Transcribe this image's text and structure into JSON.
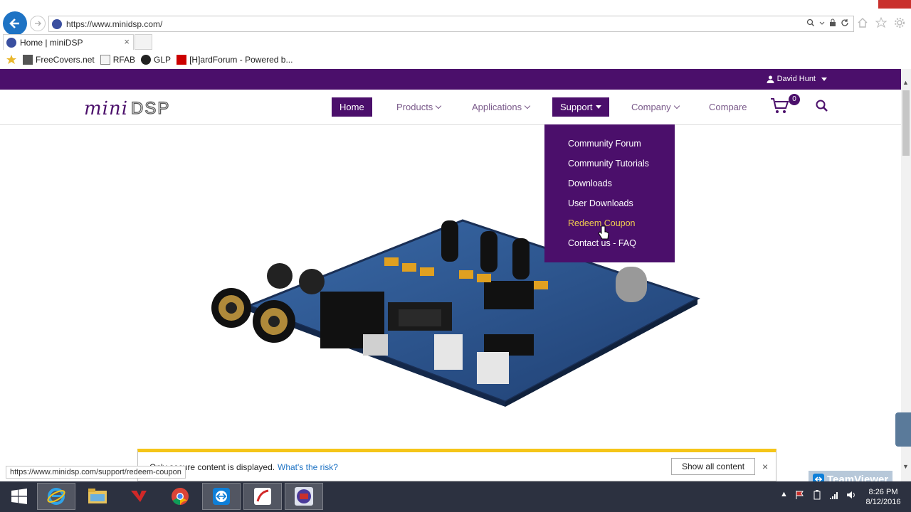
{
  "browser": {
    "url": "https://www.minidsp.com/",
    "tab_title": "Home | miniDSP",
    "tab_close": "×",
    "favorites": [
      {
        "label": "FreeCovers.net"
      },
      {
        "label": "RFAB"
      },
      {
        "label": "GLP"
      },
      {
        "label": "[H]ardForum - Powered b..."
      }
    ]
  },
  "site": {
    "user": "David Hunt",
    "logo_mini": "mini",
    "logo_dsp": "DSP",
    "nav": [
      {
        "label": "Home"
      },
      {
        "label": "Products"
      },
      {
        "label": "Applications"
      },
      {
        "label": "Support"
      },
      {
        "label": "Company"
      },
      {
        "label": "Compare"
      }
    ],
    "cart_count": "0",
    "support_menu": [
      {
        "label": "Community Forum"
      },
      {
        "label": "Community Tutorials"
      },
      {
        "label": "Downloads"
      },
      {
        "label": "User Downloads"
      },
      {
        "label": "Redeem Coupon"
      },
      {
        "label": "Contact us - FAQ"
      }
    ]
  },
  "notification": {
    "message": "Only secure content is displayed.",
    "risk_link": "What's the risk?",
    "show_button": "Show all content",
    "close": "×"
  },
  "status_url": "https://www.minidsp.com/support/redeem-coupon",
  "teamviewer": "TeamViewer",
  "taskbar": {
    "time": "8:26 PM",
    "date": "8/12/2016"
  },
  "colors": {
    "brand_purple": "#4b0f6b",
    "hover_yellow": "#f0cc50",
    "link_blue": "#1e73c4",
    "taskbar": "#2c3140"
  }
}
